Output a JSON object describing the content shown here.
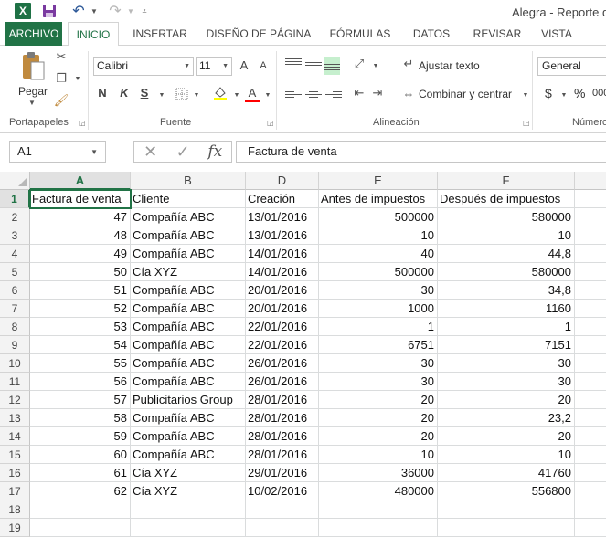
{
  "window": {
    "app_logo": "X",
    "title": "Alegra - Reporte de"
  },
  "icons": {
    "excel": "excel-logo-icon",
    "save": "save-icon",
    "undo": "undo-icon",
    "redo": "redo-icon",
    "customize": "customize-toolbar-icon"
  },
  "ribbon": {
    "tabs": [
      {
        "label": "ARCHIVO"
      },
      {
        "label": "INICIO"
      },
      {
        "label": "INSERTAR"
      },
      {
        "label": "DISEÑO DE PÁGINA"
      },
      {
        "label": "FÓRMULAS"
      },
      {
        "label": "DATOS"
      },
      {
        "label": "REVISAR"
      },
      {
        "label": "VISTA"
      }
    ],
    "clipboard": {
      "paste_label": "Pegar",
      "group_label": "Portapapeles"
    },
    "font": {
      "family": "Calibri",
      "size": "11",
      "grow": "A",
      "shrink": "A",
      "bold": "N",
      "italic": "K",
      "underline": "S",
      "font_color_letter": "A",
      "group_label": "Fuente"
    },
    "alignment": {
      "wrap_text": "Ajustar texto",
      "merge_center": "Combinar y centrar",
      "group_label": "Alineación"
    },
    "number": {
      "format": "General",
      "currency": "$",
      "percent": "%",
      "thousands": "000",
      "group_label": "Número"
    },
    "colors": {
      "accent": "#217346",
      "highlight": "#ffff00",
      "font_color": "#ff0000"
    }
  },
  "formula_bar": {
    "name_box": "A1",
    "cancel_symbol": "✕",
    "enter_symbol": "✓",
    "fx": "fx",
    "content": "Factura de venta"
  },
  "sheet": {
    "columns": [
      "A",
      "B",
      "D",
      "E",
      "F"
    ],
    "rows": [
      {
        "n": "1",
        "cells": [
          "Factura de venta",
          "Cliente",
          "Creación",
          "Antes de impuestos",
          "Después de impuestos"
        ]
      },
      {
        "n": "2",
        "cells": [
          "47",
          "Compañía ABC",
          "13/01/2016",
          "500000",
          "580000"
        ]
      },
      {
        "n": "3",
        "cells": [
          "48",
          "Compañía ABC",
          "13/01/2016",
          "10",
          "10"
        ]
      },
      {
        "n": "4",
        "cells": [
          "49",
          "Compañía ABC",
          "14/01/2016",
          "40",
          "44,8"
        ]
      },
      {
        "n": "5",
        "cells": [
          "50",
          "Cía XYZ",
          "14/01/2016",
          "500000",
          "580000"
        ]
      },
      {
        "n": "6",
        "cells": [
          "51",
          "Compañía ABC",
          "20/01/2016",
          "30",
          "34,8"
        ]
      },
      {
        "n": "7",
        "cells": [
          "52",
          "Compañía ABC",
          "20/01/2016",
          "1000",
          "1160"
        ]
      },
      {
        "n": "8",
        "cells": [
          "53",
          "Compañía ABC",
          "22/01/2016",
          "1",
          "1"
        ]
      },
      {
        "n": "9",
        "cells": [
          "54",
          "Compañía ABC",
          "22/01/2016",
          "6751",
          "7151"
        ]
      },
      {
        "n": "10",
        "cells": [
          "55",
          "Compañía ABC",
          "26/01/2016",
          "30",
          "30"
        ]
      },
      {
        "n": "11",
        "cells": [
          "56",
          "Compañía ABC",
          "26/01/2016",
          "30",
          "30"
        ]
      },
      {
        "n": "12",
        "cells": [
          "57",
          "Publicitarios Group",
          "28/01/2016",
          "20",
          "20"
        ]
      },
      {
        "n": "13",
        "cells": [
          "58",
          "Compañía ABC",
          "28/01/2016",
          "20",
          "23,2"
        ]
      },
      {
        "n": "14",
        "cells": [
          "59",
          "Compañía ABC",
          "28/01/2016",
          "20",
          "20"
        ]
      },
      {
        "n": "15",
        "cells": [
          "60",
          "Compañía ABC",
          "28/01/2016",
          "10",
          "10"
        ]
      },
      {
        "n": "16",
        "cells": [
          "61",
          "Cía XYZ",
          "29/01/2016",
          "36000",
          "41760"
        ]
      },
      {
        "n": "17",
        "cells": [
          "62",
          "Cía XYZ",
          "10/02/2016",
          "480000",
          "556800"
        ]
      },
      {
        "n": "18",
        "cells": [
          "",
          "",
          "",
          "",
          ""
        ]
      },
      {
        "n": "19",
        "cells": [
          "",
          "",
          "",
          "",
          ""
        ]
      }
    ]
  }
}
